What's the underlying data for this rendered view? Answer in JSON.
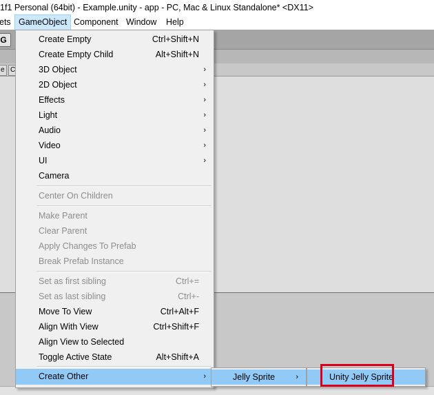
{
  "window": {
    "title": "1f1 Personal (64bit) - Example.unity - app - PC, Mac & Linux Standalone* <DX11>"
  },
  "menubar": {
    "items": [
      "ets",
      "GameObject",
      "Component",
      "Window",
      "Help"
    ]
  },
  "toolbar": {
    "left_tool_glyph": "G"
  },
  "panel_tabs": [
    "e",
    "C"
  ],
  "gameobject_menu": {
    "items": [
      {
        "label": "Create Empty",
        "shortcut": "Ctrl+Shift+N"
      },
      {
        "label": "Create Empty Child",
        "shortcut": "Alt+Shift+N"
      },
      {
        "label": "3D Object",
        "submenu": true
      },
      {
        "label": "2D Object",
        "submenu": true
      },
      {
        "label": "Effects",
        "submenu": true
      },
      {
        "label": "Light",
        "submenu": true
      },
      {
        "label": "Audio",
        "submenu": true
      },
      {
        "label": "Video",
        "submenu": true
      },
      {
        "label": "UI",
        "submenu": true
      },
      {
        "label": "Camera"
      },
      {
        "label": "Center On Children",
        "disabled": true
      },
      {
        "label": "Make Parent",
        "disabled": true
      },
      {
        "label": "Clear Parent",
        "disabled": true
      },
      {
        "label": "Apply Changes To Prefab",
        "disabled": true
      },
      {
        "label": "Break Prefab Instance",
        "disabled": true
      },
      {
        "label": "Set as first sibling",
        "shortcut": "Ctrl+=",
        "disabled": true
      },
      {
        "label": "Set as last sibling",
        "shortcut": "Ctrl+-",
        "disabled": true
      },
      {
        "label": "Move To View",
        "shortcut": "Ctrl+Alt+F"
      },
      {
        "label": "Align With View",
        "shortcut": "Ctrl+Shift+F"
      },
      {
        "label": "Align View to Selected"
      },
      {
        "label": "Toggle Active State",
        "shortcut": "Alt+Shift+A"
      },
      {
        "label": "Create Other",
        "submenu": true,
        "highlighted": true
      }
    ]
  },
  "create_other_submenu": {
    "items": [
      {
        "label": "Jelly Sprite",
        "submenu": true,
        "highlighted": true
      }
    ]
  },
  "jelly_sprite_submenu": {
    "items": [
      {
        "label": "Unity Jelly Sprite",
        "highlighted": true
      }
    ]
  },
  "icons": {
    "submenu_arrow": "chevron-right-icon"
  },
  "colors": {
    "menu_highlight": "#91c9f7",
    "menubar_active": "#cce8ff",
    "callout_border": "#d9001b",
    "disabled_text": "#8d8d8d"
  }
}
